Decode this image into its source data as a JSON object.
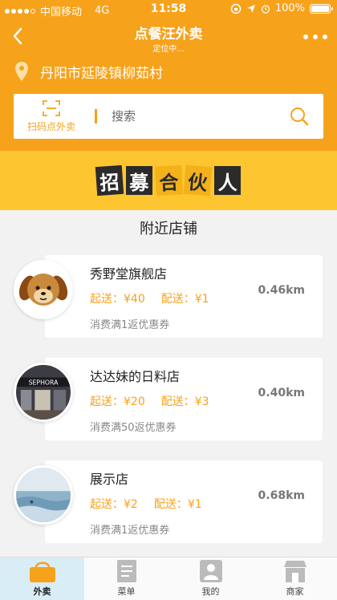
{
  "status_bar": {
    "carrier": "中国移动",
    "network": "4G",
    "time": "11:58",
    "battery": "100%"
  },
  "header": {
    "title": "点餐汪外卖",
    "subtitle": "定位中...",
    "location": "丹阳市延陵镇柳茹村"
  },
  "search": {
    "scan_label": "扫码点外卖",
    "placeholder": "搜索"
  },
  "banner": {
    "chars": [
      "招",
      "募",
      "合",
      "伙",
      "人"
    ]
  },
  "nearby": {
    "title": "附近店铺",
    "stores": [
      {
        "name": "秀野堂旗舰店",
        "delivery_min_label": "起送：¥40",
        "delivery_fee_label": "配送：¥1",
        "promo": "消费满1返优惠券",
        "distance": "0.46km",
        "logo": "dog-logo"
      },
      {
        "name": "达达妹的日料店",
        "delivery_min_label": "起送：¥20",
        "delivery_fee_label": "配送：¥3",
        "promo": "消费满50返优惠券",
        "distance": "0.40km",
        "logo": "storefront-photo"
      },
      {
        "name": "展示店",
        "delivery_min_label": "起送：¥2",
        "delivery_fee_label": "配送：¥1",
        "promo": "消费满1返优惠券",
        "distance": "0.68km",
        "logo": "ocean-photo"
      }
    ]
  },
  "tabs": [
    {
      "label": "外卖",
      "icon": "basket-icon",
      "active": true
    },
    {
      "label": "菜单",
      "icon": "menu-doc-icon",
      "active": false
    },
    {
      "label": "我的",
      "icon": "user-icon",
      "active": false
    },
    {
      "label": "商家",
      "icon": "shop-icon",
      "active": false
    }
  ],
  "colors": {
    "accent": "#f7a21b",
    "banner_bg": "#fdc530",
    "active_tab_bg": "#d9edf7"
  }
}
